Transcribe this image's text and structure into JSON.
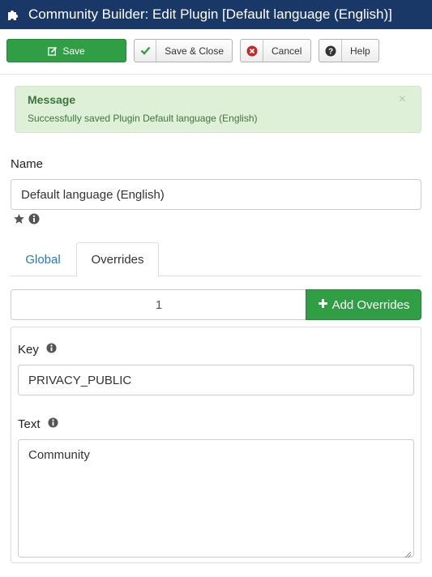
{
  "window": {
    "title": "Community Builder: Edit Plugin [Default language (English)]"
  },
  "toolbar": {
    "save_label": "Save",
    "save_close_label": "Save & Close",
    "cancel_label": "Cancel",
    "help_label": "Help"
  },
  "alert": {
    "heading": "Message",
    "message": "Successfully saved Plugin Default language (English)",
    "close_symbol": "×"
  },
  "form": {
    "name_label": "Name",
    "name_value": "Default language (English)"
  },
  "tabs": {
    "global": "Global",
    "overrides": "Overrides",
    "active": "Overrides"
  },
  "overrides": {
    "count": "1",
    "add_label": "Add Overrides",
    "entries": [
      {
        "key_label": "Key",
        "key_value": "PRIVACY_PUBLIC",
        "text_label": "Text",
        "text_value": "Community"
      }
    ]
  },
  "icons": {
    "title": "puzzle-icon",
    "save": "edit-icon",
    "save_close": "check-icon",
    "cancel": "cancel-circle-icon",
    "help": "question-circle-icon",
    "star": "star-icon",
    "info": "info-circle-icon",
    "add": "plus-icon"
  },
  "colors": {
    "titlebar": "#1a3867",
    "success": "#2f9e44",
    "alert_bg": "#dff0d8",
    "alert_text": "#3c763d",
    "link": "#1f7cc4",
    "cancel_icon": "#c52827"
  }
}
